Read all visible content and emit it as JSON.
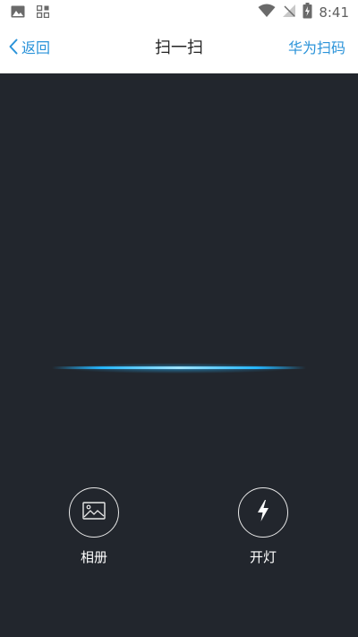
{
  "status_bar": {
    "time": "8:41",
    "left_icons": [
      "image-icon",
      "qr-grid-icon"
    ],
    "right_icons": [
      "wifi-icon",
      "no-signal-icon",
      "battery-charging-icon"
    ]
  },
  "nav": {
    "back_label": "返回",
    "title": "扫一扫",
    "action_label": "华为扫码"
  },
  "tools": {
    "album_label": "相册",
    "flash_label": "开灯"
  },
  "colors": {
    "accent": "#2a93d9",
    "scan_background": "#22262d",
    "scan_line": "#26b6ff"
  }
}
